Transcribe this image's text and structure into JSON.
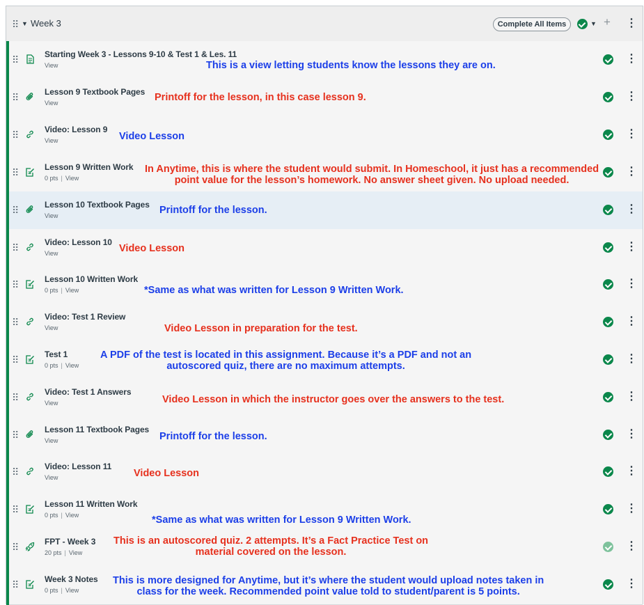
{
  "module": {
    "title": "Week 3",
    "complete_all_label": "Complete All Items",
    "drag_handle": "⠿",
    "kebab": "⋮",
    "plus": "+",
    "caret": "▼"
  },
  "items": [
    {
      "title": "Starting Week 3 - Lessons 9-10 & Test 1 & Les. 11",
      "pts": "",
      "view": "View",
      "icon": "page-icon",
      "note": "This is a view letting students know the lessons they are on.",
      "note_color": "blue",
      "published": true,
      "highlight": false
    },
    {
      "title": "Lesson 9 Textbook Pages",
      "pts": "",
      "view": "View",
      "icon": "attachment-icon",
      "note": "Printoff for the lesson, in this case lesson 9.",
      "note_color": "red",
      "published": true,
      "highlight": false
    },
    {
      "title": "Video: Lesson 9",
      "pts": "",
      "view": "View",
      "icon": "link-icon",
      "note": "Video Lesson",
      "note_color": "blue",
      "published": true,
      "highlight": false
    },
    {
      "title": "Lesson 9 Written Work",
      "pts": "0 pts",
      "view": "View",
      "icon": "assignment-icon",
      "note": "In Anytime, this is where the student would submit. In Homeschool, it just has a recommended\npoint value for the lesson’s homework. No answer sheet given. No upload needed.",
      "note_color": "red",
      "published": true,
      "highlight": false
    },
    {
      "title": "Lesson 10 Textbook Pages",
      "pts": "",
      "view": "View",
      "icon": "attachment-icon",
      "note": "Printoff for the lesson.",
      "note_color": "blue",
      "published": true,
      "highlight": true
    },
    {
      "title": "Video: Lesson 10",
      "pts": "",
      "view": "View",
      "icon": "link-icon",
      "note": "Video Lesson",
      "note_color": "red",
      "published": true,
      "highlight": false
    },
    {
      "title": "Lesson 10 Written Work",
      "pts": "0 pts",
      "view": "View",
      "icon": "assignment-icon",
      "note": "*Same as what was written for Lesson 9 Written Work.",
      "note_color": "blue",
      "published": true,
      "highlight": false
    },
    {
      "title": "Video: Test 1 Review",
      "pts": "",
      "view": "View",
      "icon": "link-icon",
      "note": "Video Lesson in preparation for the test.",
      "note_color": "red",
      "published": true,
      "highlight": false
    },
    {
      "title": "Test 1",
      "pts": "0 pts",
      "view": "View",
      "icon": "assignment-icon",
      "note": "A PDF of the test is located in this assignment. Because it’s a PDF and not an\nautoscored quiz, there are no maximum attempts.",
      "note_color": "blue",
      "published": true,
      "highlight": false
    },
    {
      "title": "Video: Test 1 Answers",
      "pts": "",
      "view": "View",
      "icon": "link-icon",
      "note": "Video Lesson in which the instructor goes over the answers to the test.",
      "note_color": "red",
      "published": true,
      "highlight": false
    },
    {
      "title": "Lesson 11 Textbook Pages",
      "pts": "",
      "view": "View",
      "icon": "attachment-icon",
      "note": "Printoff for the lesson.",
      "note_color": "blue",
      "published": true,
      "highlight": false
    },
    {
      "title": "Video: Lesson 11",
      "pts": "",
      "view": "View",
      "icon": "link-icon",
      "note": "Video Lesson",
      "note_color": "red",
      "published": true,
      "highlight": false
    },
    {
      "title": "Lesson 11 Written Work",
      "pts": "0 pts",
      "view": "View",
      "icon": "assignment-icon",
      "note": "*Same as what was written for Lesson 9 Written Work.",
      "note_color": "blue",
      "published": true,
      "highlight": false
    },
    {
      "title": "FPT - Week 3",
      "pts": "20 pts",
      "view": "View",
      "icon": "quiz-rocket-icon",
      "note": "This is an autoscored quiz. 2 attempts. It’s a Fact Practice Test on\nmaterial covered on the lesson.",
      "note_color": "red",
      "published": false,
      "highlight": false
    },
    {
      "title": "Week 3 Notes",
      "pts": "0 pts",
      "view": "View",
      "icon": "assignment-icon",
      "note": "This is more designed for Anytime, but it’s where the student would upload notes taken in\nclass for the week. Recommended point value told to student/parent is 5 points.",
      "note_color": "blue",
      "published": true,
      "highlight": false
    }
  ]
}
